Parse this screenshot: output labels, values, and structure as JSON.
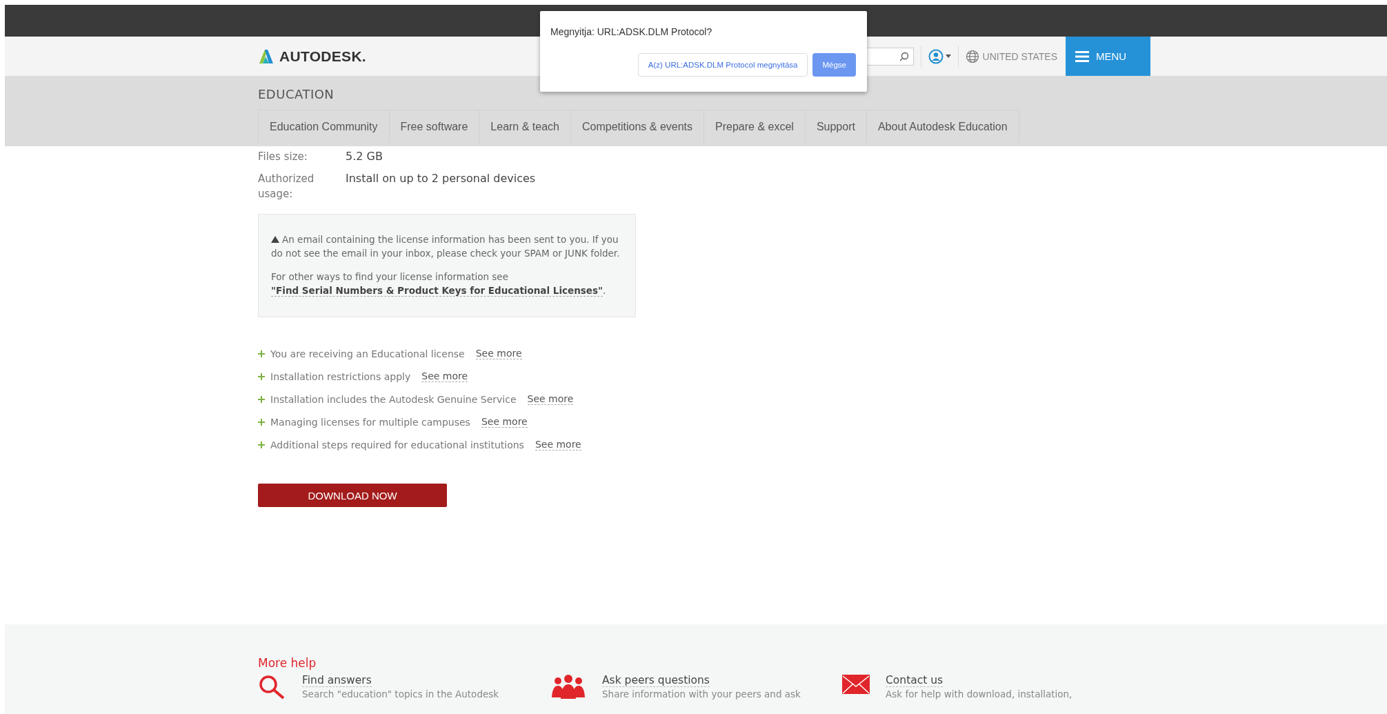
{
  "header": {
    "logo": "AUTODESK.",
    "region": "UNITED STATES",
    "menu": "MENU"
  },
  "section_title": "EDUCATION",
  "tabs": [
    {
      "label": "Education Community"
    },
    {
      "label": "Free software"
    },
    {
      "label": "Learn & teach"
    },
    {
      "label": "Competitions & events"
    },
    {
      "label": "Prepare & excel"
    },
    {
      "label": "Support"
    },
    {
      "label": "About Autodesk Education"
    }
  ],
  "details": [
    {
      "label": "Files size:",
      "value": "5.2 GB"
    },
    {
      "label": "Authorized usage:",
      "value": "Install on up to 2 personal devices"
    }
  ],
  "notice": {
    "warning": "An email containing the license information has been sent to you. If you do not see the email in your inbox, please check your SPAM or JUNK folder.",
    "text_before": "For other ways to find your license information see ",
    "link": "\"Find Serial Numbers & Product Keys for Educational Licenses\"",
    "text_after": "."
  },
  "info_items": [
    {
      "text": "You are receiving an Educational license",
      "link": "See more"
    },
    {
      "text": "Installation restrictions apply",
      "link": "See more"
    },
    {
      "text": "Installation includes the Autodesk Genuine Service",
      "link": "See more"
    },
    {
      "text": "Managing licenses for multiple campuses",
      "link": "See more"
    },
    {
      "text": "Additional steps required for educational institutions",
      "link": "See more"
    }
  ],
  "download_button": "DOWNLOAD NOW",
  "dialog": {
    "message": "Megnyitja: URL:ADSK.DLM Protocol?",
    "open_button": "A(z) URL:ADSK.DLM Protocol megnyitása",
    "cancel_button": "Mégse"
  },
  "footer": {
    "title": "More help",
    "items": [
      {
        "title": "Find answers",
        "description": "Search \"education\" topics in the Autodesk"
      },
      {
        "title": "Ask peers questions",
        "description": "Share information with your peers and ask"
      },
      {
        "title": "Contact us",
        "description": "Ask for help with download, installation,"
      }
    ]
  }
}
